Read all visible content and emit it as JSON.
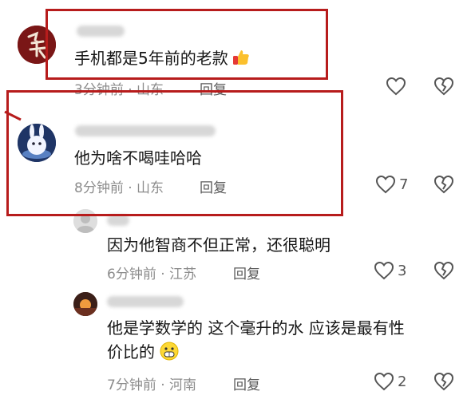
{
  "comments": [
    {
      "text": "手机都是5年前的老款",
      "meta": "3分钟前 · 山东",
      "reply": "回复",
      "likes": ""
    },
    {
      "text": "他为啥不喝哇哈哈",
      "meta": "8分钟前 · 山东",
      "reply": "回复",
      "likes": "7"
    },
    {
      "text": "因为他智商不但正常，还很聪明",
      "meta": "6分钟前 · 江苏",
      "reply": "回复",
      "likes": "3"
    },
    {
      "text_line1": "他是学数学的 这个毫升的水 应该是最有性",
      "text_line2": "价比的",
      "meta": "7分钟前 · 河南",
      "reply": "回复",
      "likes": "2"
    }
  ],
  "colors": {
    "highlight": "#b71c1c",
    "meta": "#8c8c8c",
    "text": "#161616"
  },
  "icons": [
    "like-heart-icon",
    "dislike-broken-heart-icon",
    "thumbs-up-emoji-icon",
    "grin-emoji-icon"
  ]
}
